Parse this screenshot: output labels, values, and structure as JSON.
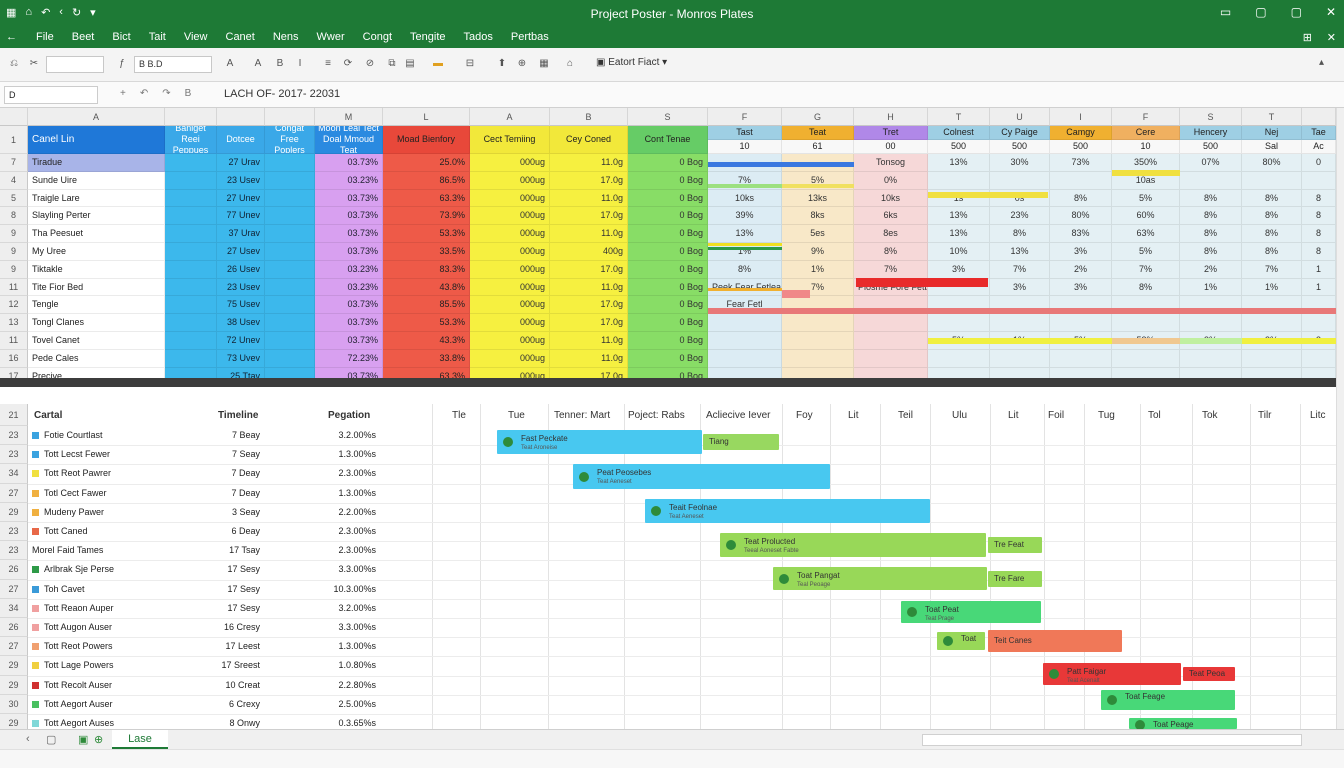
{
  "window": {
    "title": "Project Poster - Monros Plates",
    "quick_access": [
      "▦",
      "⌂",
      "↶",
      "‹",
      "↻",
      "▾"
    ],
    "controls": [
      "▭",
      "▢",
      "▢",
      "✕"
    ]
  },
  "menu": {
    "back": "←",
    "items": [
      "File",
      "Beet",
      "Bict",
      "Tait",
      "View",
      "Canet",
      "Nens",
      "Wwer",
      "Congt",
      "Tengite",
      "Tados",
      "Pertbas"
    ],
    "right_icons": [
      "⊞",
      "✕"
    ]
  },
  "toolbar": {
    "icons": [
      "⎌",
      "✂",
      "B",
      "I",
      "U",
      "ƒ",
      "A",
      "A",
      "≡",
      "⟳",
      "⊘",
      "⧉",
      "▤",
      "⊟",
      "⬆",
      "⊕",
      "⌂"
    ],
    "font_box": "B  B.D",
    "size_box": "",
    "format_label": "Eatort Fiact",
    "right": "▴"
  },
  "formula": {
    "name_box": "D",
    "icons": [
      "+",
      "↶",
      "↷",
      "B"
    ],
    "value": "LACH OF- 2017- 22031"
  },
  "columns": [
    "A",
    "",
    "",
    "",
    "M",
    "L",
    "A",
    "B",
    "S",
    "F",
    "G",
    "H",
    "T",
    "U",
    "I",
    "F",
    "S",
    "T"
  ],
  "header_row": {
    "num": "1",
    "cells": [
      "Canel Lin",
      "Baniget Reei Peppues",
      "Dotcee",
      "Congat Free Poplers",
      "Moon Leal Tect Doal Mmoud Teat",
      "Moad Bienfory",
      "Cect Temiing",
      "Cey Coned",
      "Cont Tenae",
      "Tast",
      "Teat",
      "Tret",
      "Colnest",
      "Cy Paige",
      "Camgy",
      "Cere",
      "Hencery",
      "Nej",
      "Tae"
    ],
    "subrow": [
      "",
      "",
      "",
      "",
      "",
      "",
      "",
      "",
      "",
      "10",
      "61",
      "00",
      "500",
      "500",
      "500",
      "10",
      "500",
      "Sal",
      "Ac"
    ]
  },
  "rows": [
    {
      "num": "7",
      "cells": [
        "Tiradue",
        "",
        "27 Urav",
        "",
        "03.73%",
        "25.0%",
        "000ug",
        "11.0g",
        "0 Bog"
      ],
      "extra": [
        "",
        "",
        "Tonsog",
        "13%",
        "30%",
        "73%",
        "350%",
        "07%",
        "80%",
        "0"
      ]
    },
    {
      "num": "4",
      "cells": [
        "Sunde Uire",
        "",
        "23 Usev",
        "",
        "03.23%",
        "86.5%",
        "000ug",
        "17.0g",
        "0 Bog"
      ],
      "extra": [
        "7%",
        "5%",
        "0%",
        "",
        "",
        "",
        "10as",
        "",
        "",
        ""
      ]
    },
    {
      "num": "5",
      "cells": [
        "Traigle Lare",
        "",
        "27 Unev",
        "",
        "03.73%",
        "63.3%",
        "000ug",
        "11.0g",
        "0 Bog"
      ],
      "extra": [
        "10ks",
        "13ks",
        "10ks",
        "1s",
        "0s",
        "8%",
        "5%",
        "8%",
        "8%",
        "8"
      ]
    },
    {
      "num": "8",
      "cells": [
        "Slayling Perter",
        "",
        "77 Unev",
        "",
        "03.73%",
        "73.9%",
        "000ug",
        "17.0g",
        "0 Bog"
      ],
      "extra": [
        "39%",
        "8ks",
        "6ks",
        "13%",
        "23%",
        "80%",
        "60%",
        "8%",
        "8%",
        "8"
      ]
    },
    {
      "num": "9",
      "cells": [
        "Tha Peesuet",
        "",
        "37 Urav",
        "",
        "03.73%",
        "53.3%",
        "000ug",
        "11.0g",
        "0 Bog"
      ],
      "extra": [
        "13%",
        "5es",
        "8es",
        "13%",
        "8%",
        "83%",
        "63%",
        "8%",
        "8%",
        "8"
      ]
    },
    {
      "num": "9",
      "cells": [
        "My Uree",
        "",
        "27 Usev",
        "",
        "03.73%",
        "33.5%",
        "000ug",
        "400g",
        "0 Bog"
      ],
      "extra": [
        "1%",
        "9%",
        "8%",
        "10%",
        "13%",
        "3%",
        "5%",
        "8%",
        "8%",
        "8"
      ]
    },
    {
      "num": "9",
      "cells": [
        "Tiktakle",
        "",
        "26 Usev",
        "",
        "03.23%",
        "83.3%",
        "000ug",
        "17.0g",
        "0 Bog"
      ],
      "extra": [
        "8%",
        "1%",
        "7%",
        "3%",
        "7%",
        "2%",
        "7%",
        "2%",
        "7%",
        "1"
      ]
    },
    {
      "num": "11",
      "cells": [
        "Tite Fior Bed",
        "",
        "23 Usev",
        "",
        "03.23%",
        "43.8%",
        "000ug",
        "11.0g",
        "0 Bog"
      ],
      "extra": [
        "Peek Fear Fetleanbeb",
        "7%",
        "Plosme Fore Fetbeb",
        "",
        "3%",
        "3%",
        "8%",
        "1%",
        "1%",
        "1"
      ]
    },
    {
      "num": "12",
      "cells": [
        "Tengle",
        "",
        "75 Usev",
        "",
        "03.73%",
        "85.5%",
        "000ug",
        "17.0g",
        "0 Bog"
      ],
      "extra": [
        "Fear Fetl",
        "",
        "",
        "",
        "",
        "",
        "",
        "",
        "",
        ""
      ]
    },
    {
      "num": "13",
      "cells": [
        "Tongl Clanes",
        "",
        "38 Usev",
        "",
        "03.73%",
        "53.3%",
        "000ug",
        "17.0g",
        "0 Bog"
      ],
      "extra": [
        "",
        "",
        "",
        "",
        "",
        "",
        "",
        "",
        "",
        ""
      ]
    },
    {
      "num": "11",
      "cells": [
        "Tovel Canet",
        "",
        "72 Unev",
        "",
        "03.73%",
        "43.3%",
        "000ug",
        "11.0g",
        "0 Bog"
      ],
      "extra": [
        "",
        "",
        "",
        "5%",
        "1%",
        "5%",
        "53%",
        "3%",
        "3%",
        "3"
      ]
    },
    {
      "num": "16",
      "cells": [
        "Pede Cales",
        "",
        "73 Uvev",
        "",
        "72.23%",
        "33.8%",
        "000ug",
        "11.0g",
        "0 Bog"
      ],
      "extra": [
        "",
        "",
        "",
        "",
        "",
        "",
        "",
        "",
        "",
        ""
      ]
    },
    {
      "num": "17",
      "cells": [
        "Precive",
        "",
        "25 Ttav",
        "",
        "03.73%",
        "63.3%",
        "000ug",
        "17.0g",
        "0 Bog"
      ],
      "extra": [
        "",
        "",
        "",
        "",
        "",
        "",
        "",
        "",
        "",
        ""
      ]
    }
  ],
  "gantt": {
    "row_num": "21",
    "headers": [
      "Cartal",
      "Timeline",
      "Pegation"
    ],
    "timeline": [
      "Tle",
      "Tue",
      "Tenner: Mart",
      "Poject: Rabs",
      "Acliecive Iever",
      "Foy",
      "Lit",
      "Teil",
      "Ulu",
      "Lit",
      "Foil",
      "Tug",
      "Tol",
      "Tok",
      "Tilr",
      "Litc"
    ],
    "tasks": [
      {
        "num": "23",
        "name": "Fotie Courtlast",
        "color": "#3aa3e0",
        "dur": "7 Beay",
        "prog": "3.2.00%s"
      },
      {
        "num": "23",
        "name": "Tott Lecst Fewer",
        "color": "#3aa3e0",
        "dur": "7 Seay",
        "prog": "1.3.00%s"
      },
      {
        "num": "34",
        "name": "Tott Reot Pawrer",
        "color": "#f0e040",
        "dur": "7 Deay",
        "prog": "2.3.00%s"
      },
      {
        "num": "27",
        "name": "Totl Cect Fawer",
        "color": "#f0b040",
        "dur": "7 Deay",
        "prog": "1.3.00%s"
      },
      {
        "num": "29",
        "name": "Mudeny Pawer",
        "color": "#f0b040",
        "dur": "3 Seay",
        "prog": "2.2.00%s"
      },
      {
        "num": "23",
        "name": "Tott Caned",
        "color": "#e86848",
        "dur": "6 Deay",
        "prog": "2.3.00%s"
      },
      {
        "num": "23",
        "name": "Morel Faid Tames",
        "color": "",
        "dur": "17 Tsay",
        "prog": "2.3.00%s"
      },
      {
        "num": "26",
        "name": "Arlbrak Sje Perse",
        "color": "#2e9a48",
        "dur": "17 Sesy",
        "prog": "3.3.00%s"
      },
      {
        "num": "27",
        "name": "Toh Cavet",
        "color": "#3a9ad8",
        "dur": "17 Sesy",
        "prog": "10.3.00%s"
      },
      {
        "num": "34",
        "name": "Tott Reaon Auper",
        "color": "#f0a0a0",
        "dur": "17 Sesy",
        "prog": "3.2.00%s"
      },
      {
        "num": "26",
        "name": "Tott Augon Auser",
        "color": "#f0a0a0",
        "dur": "16 Cresy",
        "prog": "3.3.00%s"
      },
      {
        "num": "27",
        "name": "Tott Reot Powers",
        "color": "#f0a070",
        "dur": "17 Leest",
        "prog": "1.3.00%s"
      },
      {
        "num": "29",
        "name": "Tott Lage Powers",
        "color": "#f0d040",
        "dur": "17 Sreest",
        "prog": "1.0.80%s"
      },
      {
        "num": "29",
        "name": "Tott Recolt Auser",
        "color": "#d03030",
        "dur": "10 Creat",
        "prog": "2.2.80%s"
      },
      {
        "num": "30",
        "name": "Tott Aegort Auser",
        "color": "#48c060",
        "dur": "6 Crexy",
        "prog": "2.5.00%s"
      },
      {
        "num": "29",
        "name": "Tott Aegort Auses",
        "color": "#80d8d8",
        "dur": "8 Onwy",
        "prog": "0.3.65%s"
      }
    ],
    "bars": [
      {
        "label": "Fast Peckate",
        "sub": "Teat Aroneise",
        "tail": "Tiang"
      },
      {
        "label": "Peat Peosebes",
        "sub": "Teat Aeneset"
      },
      {
        "label": "Teait Feolnae",
        "sub": "Teat Aeneset"
      },
      {
        "label": "Teat Prolucted",
        "sub": "Teeal Aoneset Fabte",
        "tail": "Tre Feat"
      },
      {
        "label": "Toat Pangat",
        "sub": "Teal Peoage",
        "tail": "Tre Fare"
      },
      {
        "label": "Toat Peat",
        "sub": "Teat Prage"
      },
      {
        "label": "Toat",
        "sub": "",
        "tail": "Teit Canes"
      },
      {
        "label": "Patt Faigar",
        "sub": "Teat Acenalt",
        "tail": "Teat Peoa"
      },
      {
        "label": "Toat Feage",
        "sub": ""
      },
      {
        "label": "Toat Peage",
        "sub": ""
      }
    ]
  },
  "sheets": {
    "nav": [
      "‹",
      "▢"
    ],
    "icons": [
      "▣",
      "⊕"
    ],
    "active": "Lase"
  },
  "status": {
    "text": "",
    "zoom": ""
  }
}
